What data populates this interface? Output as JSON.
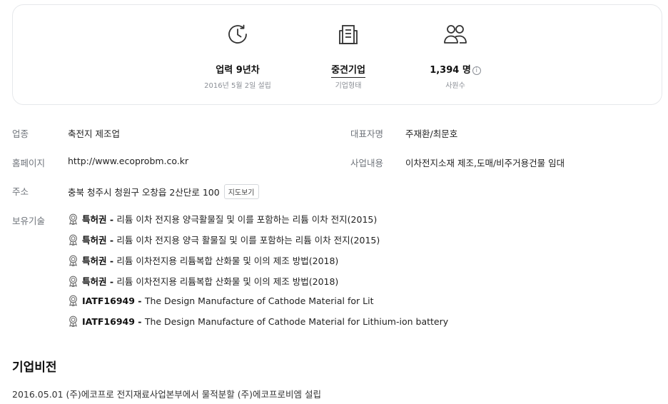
{
  "stats": [
    {
      "value": "업력 9년차",
      "sub": "2016년 5월 2일 설립",
      "icon": "clock-icon"
    },
    {
      "value": "중견기업",
      "sub": "기업형태",
      "icon": "building-icon"
    },
    {
      "value": "1,394 명",
      "sub": "사원수",
      "icon": "people-icon"
    }
  ],
  "info": {
    "industry_label": "업종",
    "industry": "축전지 제조업",
    "ceo_label": "대표자명",
    "ceo": "주재환/최문호",
    "homepage_label": "홈페이지",
    "homepage": "http://www.ecoprobm.co.kr",
    "business_label": "사업내용",
    "business": "이차전지소재 제조,도매/비주거용건물 임대",
    "address_label": "주소",
    "address": "충북 청주시 청원구 오창읍 2산단로 100",
    "map_button": "지도보기",
    "tech_label": "보유기술"
  },
  "tech": [
    {
      "kind": "특허권",
      "sep": " - ",
      "desc": "리튬 이차 전지용 양극활물질 및 이를 포함하는 리튬 이차 전지(2015)"
    },
    {
      "kind": "특허권",
      "sep": " - ",
      "desc": "리튬 이차 전지용 양극 활물질 및 이를 포함하는 리튬 이차 전지(2015)"
    },
    {
      "kind": "특허권",
      "sep": " - ",
      "desc": "리튬 이차전지용 리튬복합 산화물 및 이의 제조 방법(2018)"
    },
    {
      "kind": "특허권",
      "sep": " - ",
      "desc": "리튬 이차전지용 리튬복합 산화물 및 이의 제조 방법(2018)"
    },
    {
      "kind": "IATF16949",
      "sep": " - ",
      "desc": "The Design Manufacture of Cathode Material for Lit"
    },
    {
      "kind": "IATF16949",
      "sep": " - ",
      "desc": "The Design Manufacture of Cathode Material for Lithium-ion battery"
    }
  ],
  "vision": {
    "title": "기업비전",
    "text": "2016.05.01 (주)에코프로 전지재료사업본부에서 물적분할 (주)에코프로비엠 설립"
  }
}
